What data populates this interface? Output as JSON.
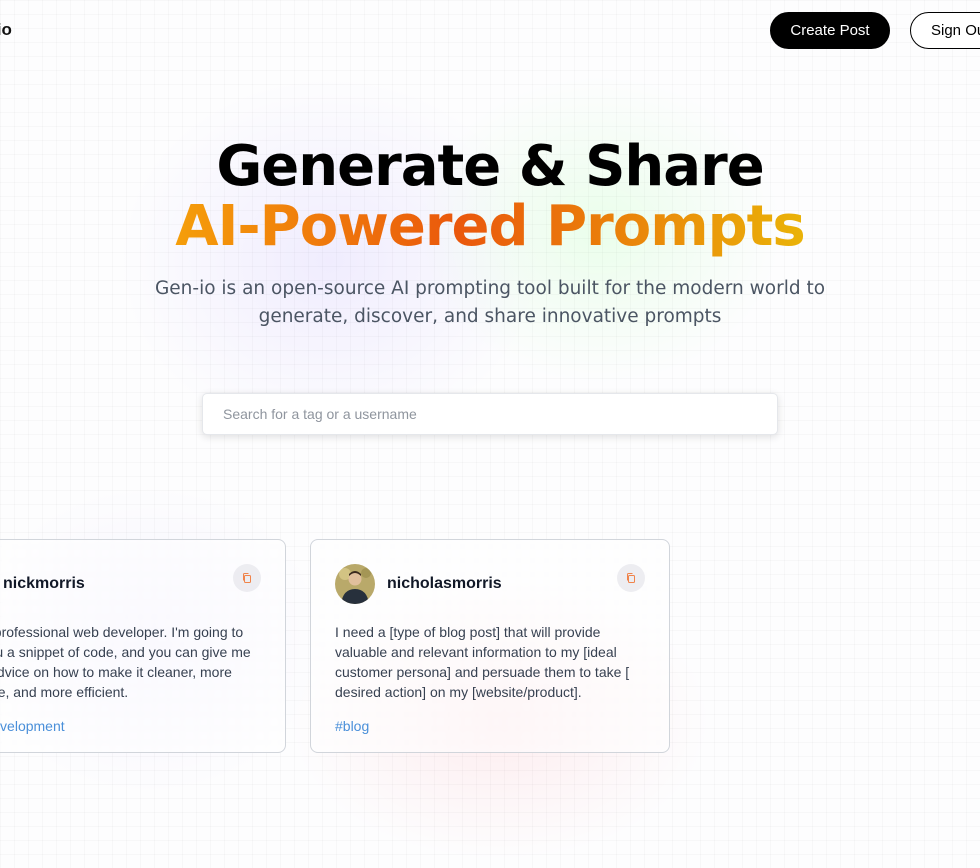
{
  "nav": {
    "logo_text": "Gen-io",
    "create_post_label": "Create Post",
    "sign_out_label": "Sign Out"
  },
  "hero": {
    "title_line1": "Generate & Share",
    "title_line2": "AI-Powered Prompts",
    "description": "Gen-io is an open-source AI prompting tool built for the modern world to generate, discover, and share innovative prompts"
  },
  "search": {
    "placeholder": "Search for a tag or a username",
    "value": ""
  },
  "prompts": [
    {
      "username": "nickmorris",
      "text": "I am a professional web developer. I'm going to give you a snippet of code, and you can give me some advice on how to make it cleaner, more readable, and more efficient.",
      "tag": "#webdevelopment",
      "avatar_icon": "user-avatar",
      "copy_icon": "copy-icon"
    },
    {
      "username": "nicholasmorris",
      "text": "I need a [type of blog post] that will provide valuable and relevant information to my [ideal customer persona] and persuade them to take [ desired action] on my [website/product].",
      "tag": "#blog",
      "avatar_icon": "user-avatar",
      "copy_icon": "copy-icon"
    }
  ],
  "colors": {
    "accent_gradient_start": "#f59e0b",
    "accent_gradient_mid": "#ea580c",
    "accent_gradient_end": "#eab308",
    "tag_blue": "#4a8fd9",
    "copy_icon_orange": "#f0834a"
  }
}
